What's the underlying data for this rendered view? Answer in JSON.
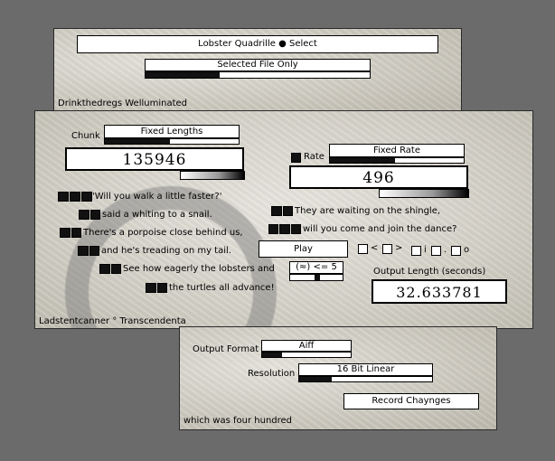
{
  "top": {
    "title_bar": "Lobster Quadrille ● Select",
    "file_mode": "Selected File Only",
    "footer": "Drinkthedregs Welluminated"
  },
  "main": {
    "chunk_label": "Chunk",
    "chunk_mode": "Fixed Lengths",
    "chunk_value": "135946",
    "rate_label": "Rate",
    "rate_mode": "Fixed Rate",
    "rate_value": "496",
    "lines": [
      "'Will you walk a little faster?'",
      "said a whiting to a snail.",
      "There's a porpoise close behind us,",
      "and he's treading on my tail.",
      "See how eagerly the lobsters and",
      "the turtles all advance!",
      "They are waiting on the shingle,",
      "will you come and join the dance?"
    ],
    "play_label": "Play",
    "lt_label": "<",
    "gt_label": ">",
    "i_label": "i",
    "dot_label": ".",
    "o_label": "o",
    "approx_label": "(≈) <= 5",
    "output_length_label": "Output Length (seconds)",
    "output_length_value": "32.633781",
    "footer": "Ladstentcanner ° Transcendenta"
  },
  "bottom": {
    "format_label": "Output Format",
    "format_value": "Aiff",
    "resolution_label": "Resolution",
    "resolution_value": "16 Bit Linear",
    "record_label": "Record Chaynges",
    "footer": "which was four hundred"
  }
}
